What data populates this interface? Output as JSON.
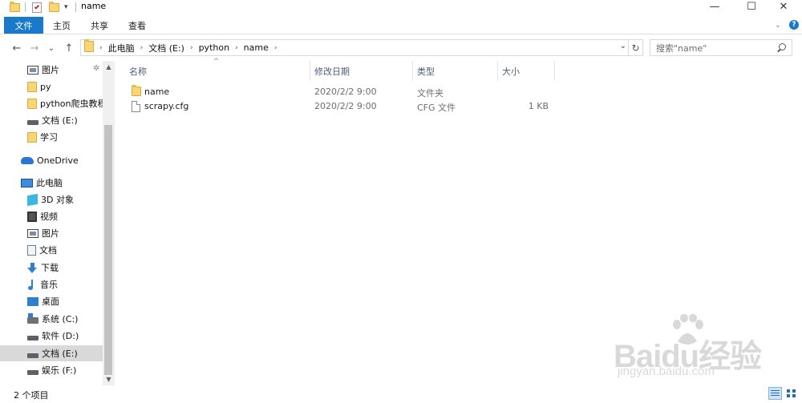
{
  "window": {
    "title": "name",
    "minimize_glyph": "—",
    "maximize_glyph": "☐",
    "close_glyph": "✕"
  },
  "quick_access": {
    "dropdown_glyph": "▾"
  },
  "ribbon": {
    "tabs": [
      "文件",
      "主页",
      "共享",
      "查看"
    ],
    "expand_glyph": "⌄",
    "help_glyph": "?"
  },
  "nav": {
    "back_glyph": "←",
    "forward_glyph": "→",
    "recent_glyph": "⌄",
    "up_glyph": "↑",
    "breadcrumb": [
      "此电脑",
      "文档 (E:)",
      "python",
      "name"
    ],
    "separator_glyph": "›",
    "dropdown_glyph": "⌄",
    "refresh_glyph": "↻"
  },
  "search": {
    "placeholder": "搜索\"name\""
  },
  "sidebar": {
    "items": [
      {
        "label": "图片",
        "icon": "picture-icon",
        "pinned": true
      },
      {
        "label": "py",
        "icon": "folder-icon"
      },
      {
        "label": "python爬虫教程",
        "icon": "folder-icon"
      },
      {
        "label": "文档 (E:)",
        "icon": "drive-icon"
      },
      {
        "label": "学习",
        "icon": "folder-icon"
      },
      {
        "label": "OneDrive",
        "icon": "onedrive-icon"
      },
      {
        "label": "此电脑",
        "icon": "this-pc-icon"
      },
      {
        "label": "3D 对象",
        "icon": "3d-objects-icon"
      },
      {
        "label": "视频",
        "icon": "video-icon"
      },
      {
        "label": "图片",
        "icon": "picture-icon"
      },
      {
        "label": "文档",
        "icon": "documents-icon"
      },
      {
        "label": "下载",
        "icon": "download-icon"
      },
      {
        "label": "音乐",
        "icon": "music-icon"
      },
      {
        "label": "桌面",
        "icon": "desktop-icon"
      },
      {
        "label": "系统 (C:)",
        "icon": "system-drive-icon"
      },
      {
        "label": "软件 (D:)",
        "icon": "drive-icon"
      },
      {
        "label": "文档 (E:)",
        "icon": "drive-icon",
        "selected": true
      },
      {
        "label": "娱乐 (F:)",
        "icon": "drive-icon"
      }
    ],
    "pin_glyph": "✲",
    "scroll_up_glyph": "▲",
    "scroll_down_glyph": "▼"
  },
  "file_list": {
    "sort_glyph": "^",
    "columns": [
      "名称",
      "修改日期",
      "类型",
      "大小"
    ],
    "rows": [
      {
        "name": "name",
        "modified": "2020/2/2 9:00",
        "type": "文件夹",
        "size": "",
        "icon": "folder-icon"
      },
      {
        "name": "scrapy.cfg",
        "modified": "2020/2/2 9:00",
        "type": "CFG 文件",
        "size": "1 KB",
        "icon": "file-icon"
      }
    ]
  },
  "status_bar": {
    "item_count": "2 个项目",
    "active_view": "details"
  },
  "watermark": {
    "brand": "Baidu经验",
    "url": "jingyan.baidu.com"
  },
  "colors": {
    "accent": "#1979ca",
    "selection": "#d9d9d9",
    "folder": "#f8d675",
    "header_text": "#4c607a"
  }
}
